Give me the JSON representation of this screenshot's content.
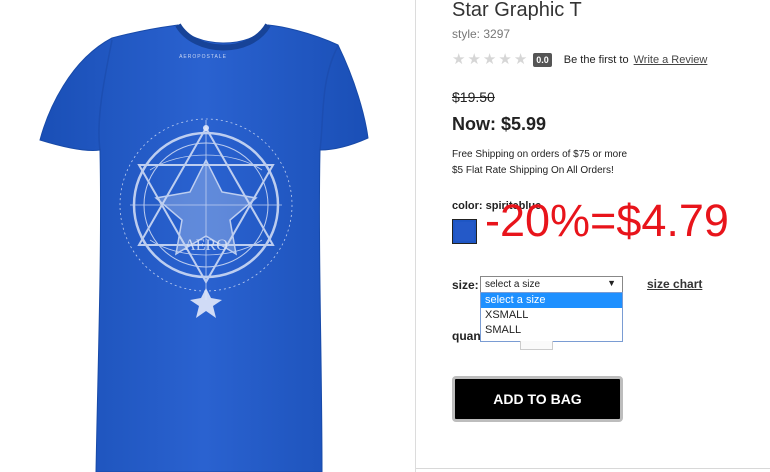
{
  "product": {
    "title": "Star Graphic T",
    "style": "style: 3297",
    "rating_value": "0.0",
    "rating_stars": 0,
    "rating_max": 5,
    "first_review_text": "Be the first to",
    "write_review_link": "Write a Review",
    "original_price": "$19.50",
    "now_price": "Now: $5.99",
    "shipping_line_1": "Free Shipping on orders of $75 or more",
    "shipping_line_2": "$5 Flat Rate Shipping On All Orders!",
    "color_label": "color: spiriteblue",
    "swatch_color": "#2459c8",
    "shirt_color": "#1f57c2",
    "shirt_graphic_text": "AERO",
    "shirt_tag_text": "AEROPOSTALE"
  },
  "annotation": {
    "text": "-20%=$4.79",
    "color": "#e8141b"
  },
  "size": {
    "label": "size:",
    "selected": "select a size",
    "options": [
      "select a size",
      "XSMALL",
      "SMALL"
    ],
    "chart_link": "size chart"
  },
  "quantity": {
    "label": "quantity:"
  },
  "actions": {
    "add_to_bag": "ADD TO BAG"
  }
}
